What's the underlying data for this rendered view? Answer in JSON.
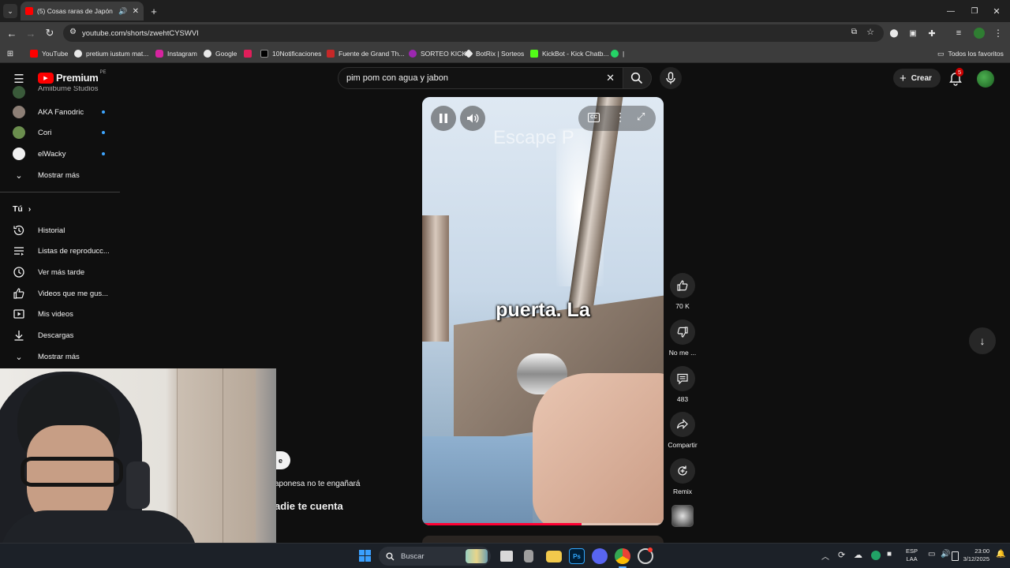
{
  "browser": {
    "tab_title": "(5) Cosas raras de Japón qu",
    "url": "youtube.com/shorts/zwehtCYSWVI",
    "bookmarks": [
      "YouTube",
      "pretium iustum mat...",
      "Instagram",
      "Google",
      "10Notificaciones",
      "Fuente de Grand Th...",
      "SORTEO KICK",
      "BotRix | Sorteos",
      "KickBot - Kick Chatb...",
      "|"
    ],
    "all_bookmarks": "Todos los favoritos"
  },
  "youtube": {
    "logo_text": "Premium",
    "region": "PE",
    "search_value": "pim pom con agua y jabon",
    "create_label": "Crear",
    "notification_count": "5"
  },
  "sidebar": {
    "partial_top": "Amiibume Studios",
    "subscriptions": [
      {
        "name": "AKA Fanodric"
      },
      {
        "name": "Cori"
      },
      {
        "name": "elWacky"
      }
    ],
    "show_more_subs": "Mostrar más",
    "you_header": "Tú",
    "items": [
      {
        "label": "Historial",
        "icon": "history-icon"
      },
      {
        "label": "Listas de reproducc...",
        "icon": "playlist-icon"
      },
      {
        "label": "Ver más tarde",
        "icon": "clock-icon"
      },
      {
        "label": "Videos que me gus...",
        "icon": "thumbs-up-icon"
      },
      {
        "label": "Mis videos",
        "icon": "play-square-icon"
      },
      {
        "label": "Descargas",
        "icon": "download-icon"
      }
    ],
    "show_more_you": "Mostrar más"
  },
  "video": {
    "watermark": "Escape P",
    "caption": "puerta. La",
    "progress": 0.66,
    "behind_text_1": "aponesa no te engañará",
    "behind_text_2": "adie te cuenta",
    "behind_pill": "e"
  },
  "actions": {
    "likes": "70 K",
    "dislike": "No me ...",
    "comments": "483",
    "share": "Compartir",
    "remix": "Remix"
  },
  "taskbar": {
    "search_placeholder": "Buscar",
    "lang_line1": "ESP",
    "lang_line2": "LAA",
    "time": "23:00",
    "date": "3/12/2025"
  },
  "colors": {
    "brand_red": "#ff0000",
    "progress": "#ff0033",
    "background": "#0f0f0f"
  }
}
